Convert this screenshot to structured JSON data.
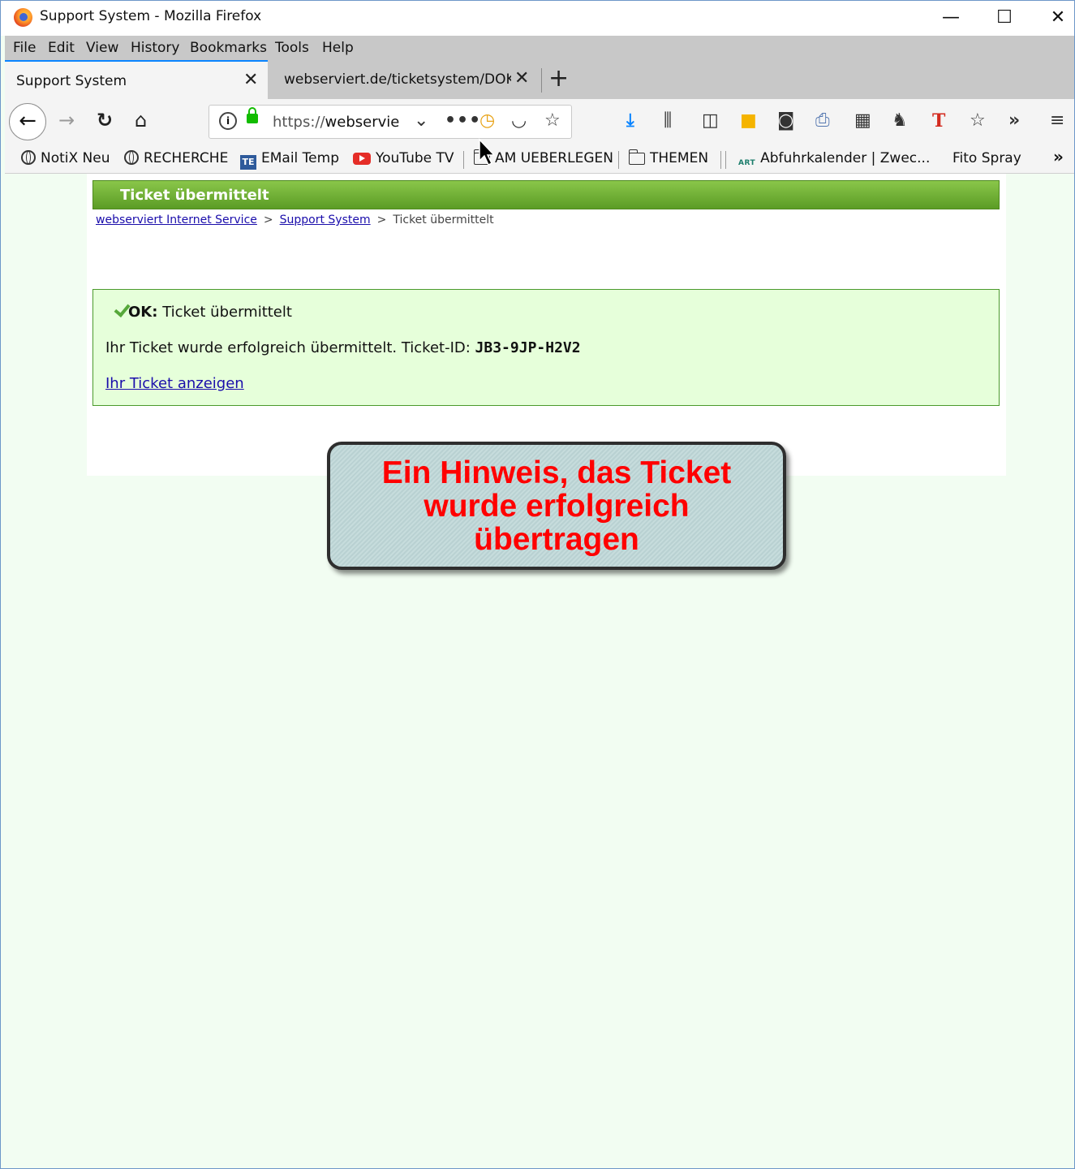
{
  "window": {
    "title": "Support System - Mozilla Firefox",
    "controls": {
      "minimize": "—",
      "maximize": "☐",
      "close": "✕"
    }
  },
  "menu": [
    {
      "label": "File"
    },
    {
      "label": "Edit"
    },
    {
      "label": "View"
    },
    {
      "label": "History"
    },
    {
      "label": "Bookmarks"
    },
    {
      "label": "Tools"
    },
    {
      "label": "Help"
    }
  ],
  "tabs": [
    {
      "label": "Support System",
      "close": "✕"
    },
    {
      "label": "webserviert.de/ticketsystem/DOKU/",
      "close": "✕"
    }
  ],
  "new_tab": "+",
  "nav": {
    "url_prefix": "https://",
    "url_host": "webservie",
    "icons": [
      "back-arrow-icon",
      "forward-arrow-icon",
      "reload-icon",
      "home-icon",
      "info-icon",
      "lock-icon",
      "dropdown-icon",
      "more-icon",
      "clock-extension-icon",
      "pocket-icon",
      "star-icon",
      "download-icon",
      "library-icon",
      "sidebar-icon",
      "note-icon",
      "camera-icon",
      "print-icon",
      "screenshot-icon",
      "cat-icon",
      "t-icon",
      "star-outline-icon",
      "overflow-icon",
      "hamburger-menu-icon"
    ]
  },
  "bookmarks": [
    {
      "label": "NotiX Neu"
    },
    {
      "label": "RECHERCHE"
    },
    {
      "label": "EMail Temp"
    },
    {
      "label": "YouTube TV"
    },
    {
      "label": "AM UEBERLEGEN"
    },
    {
      "label": "THEMEN"
    },
    {
      "label": "Abfuhrkalender | Zwec..."
    },
    {
      "label": "Fito Spray"
    }
  ],
  "bookmark_icons": {
    "te": "TE",
    "art": "ART"
  },
  "page": {
    "header": "Ticket übermittelt",
    "breadcrumb": [
      {
        "label": "webserviert Internet Service",
        "link": true
      },
      {
        "label": "Support System",
        "link": true
      },
      {
        "label": "Ticket übermittelt",
        "link": false
      }
    ],
    "breadcrumb_sep": ">",
    "ok": {
      "prefix": "OK:",
      "title": "Ticket übermittelt",
      "message": "Ihr Ticket wurde erfolgreich übermittelt. Ticket-ID:",
      "ticket_id": "JB3-9JP-H2V2",
      "link": "Ihr Ticket anzeigen"
    }
  },
  "callout": {
    "line1": "Ein Hinweis, das Ticket",
    "line2": "wurde erfolgreich",
    "line3": "übertragen"
  },
  "colors": {
    "header_green": "#6aa92f",
    "ok_bg": "#e6ffda",
    "callout_text": "#ff0000",
    "link": "#1a0dab"
  }
}
